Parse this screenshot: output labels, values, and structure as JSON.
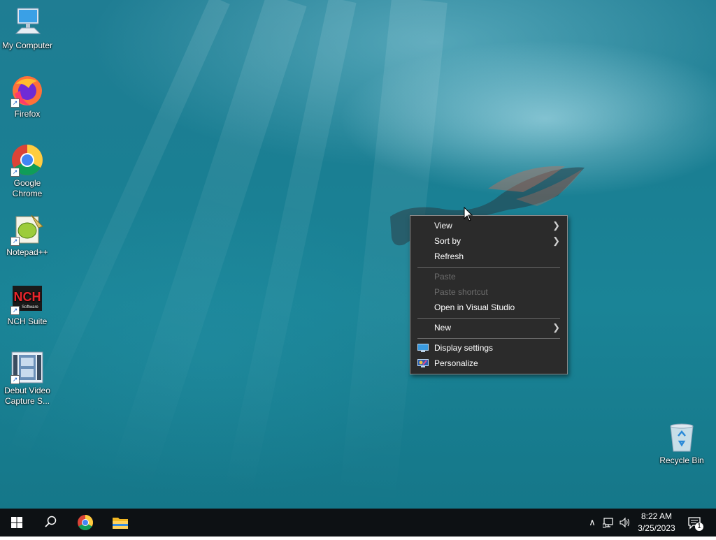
{
  "desktop_icons": [
    {
      "id": "my-computer",
      "label": "My Computer",
      "icon": "monitor-icon"
    },
    {
      "id": "firefox",
      "label": "Firefox",
      "icon": "firefox-icon"
    },
    {
      "id": "google-chrome",
      "label": "Google Chrome",
      "icon": "chrome-icon"
    },
    {
      "id": "notepad-plus-plus",
      "label": "Notepad++",
      "icon": "notepad-plus-plus-icon"
    },
    {
      "id": "nch-suite",
      "label": "NCH Suite",
      "icon": "nch-icon"
    },
    {
      "id": "debut-video",
      "label": "Debut Video Capture S...",
      "icon": "film-strip-icon"
    },
    {
      "id": "recycle-bin",
      "label": "Recycle Bin",
      "icon": "recycle-bin-icon"
    }
  ],
  "nch_logo_text": "NCH",
  "nch_logo_subtext": "Software",
  "context_menu": {
    "view": "View",
    "sort_by": "Sort by",
    "refresh": "Refresh",
    "paste": "Paste",
    "paste_shortcut": "Paste shortcut",
    "open_in_visual_studio": "Open in Visual Studio",
    "new": "New",
    "display_settings": "Display settings",
    "personalize": "Personalize"
  },
  "taskbar": {
    "start_icon": "windows-logo-icon",
    "search_icon": "search-icon",
    "pinned": [
      "chrome-icon",
      "file-explorer-icon"
    ],
    "tray_icons": [
      "chevron-up-icon",
      "network-icon",
      "volume-icon"
    ],
    "time": "8:22 AM",
    "date": "3/25/2023",
    "notification_count": "1"
  },
  "colors": {
    "menu_bg": "#2b2b2b",
    "taskbar_bg": "#0d1114",
    "disabled_text": "#6d6d6d"
  }
}
